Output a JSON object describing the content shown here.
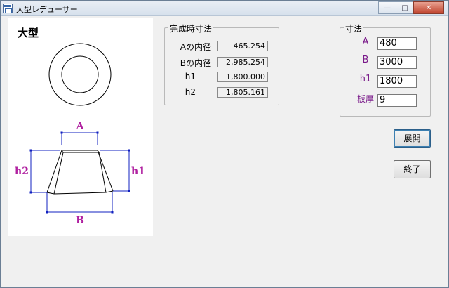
{
  "window": {
    "title": "大型レデューサー"
  },
  "drawing": {
    "caption": "大型",
    "label_a": "A",
    "label_b": "B",
    "label_h1": "h1",
    "label_h2": "h2",
    "label_color": "#b020a0",
    "dim_color": "#1020c0"
  },
  "results": {
    "title": "完成時寸法",
    "rows": [
      {
        "label": "Aの内径",
        "value": "465.254"
      },
      {
        "label": "Bの内径",
        "value": "2,985.254"
      },
      {
        "label": "h1",
        "value": "1,800.000"
      },
      {
        "label": "h2",
        "value": "1,805.161"
      }
    ]
  },
  "inputs": {
    "title": "寸法",
    "fields": [
      {
        "label": "A",
        "value": "480"
      },
      {
        "label": "B",
        "value": "3000"
      },
      {
        "label": "h1",
        "value": "1800"
      },
      {
        "label": "板厚",
        "value": "9"
      }
    ]
  },
  "buttons": {
    "expand": "展開",
    "exit": "終了"
  }
}
